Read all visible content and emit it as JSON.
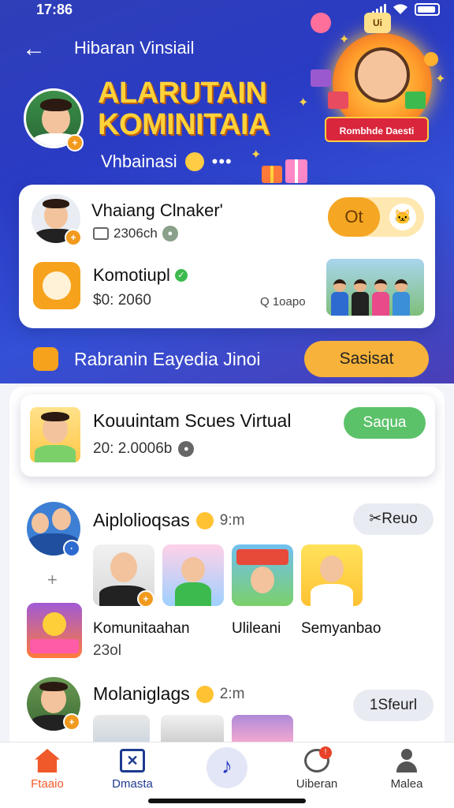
{
  "status_bar": {
    "time": "17:86"
  },
  "header": {
    "title": "Hibaran Vinsiail"
  },
  "promo": {
    "banner_text": "Rombhde Daesti",
    "badge_text": "Ui"
  },
  "hero": {
    "title_line1": "ALARUTAIN",
    "title_line2": "KOMINITAIA",
    "subtitle": "Vhbainasi",
    "dots": "•••"
  },
  "card1": {
    "user_name": "Vhaiang Clnaker'",
    "user_meta": "2306ch",
    "toggle_label": "Ot",
    "app_name": "Komotiupl",
    "app_meta": "$0: 2060",
    "search_meta": "Q 1oapo"
  },
  "section": {
    "title": "Rabranin Eayedia Jinoi",
    "button_label": "Sasisat"
  },
  "card2": {
    "title": "Kouuintam Scues Virtual",
    "meta": "20: 2.0006b",
    "button_label": "Saqua"
  },
  "post1": {
    "name": "Aiplolioqsas",
    "time": "9:m",
    "button_label": "Reuo",
    "captions": [
      "Komunitaahan",
      "Ulileani",
      "Semyanbao"
    ],
    "sub_caption": "23ol"
  },
  "post2": {
    "name": "Molaniglags",
    "time": "2:m",
    "button_label": "1Sfeurl"
  },
  "bottom_nav": {
    "items": [
      {
        "label": "Ftaaio"
      },
      {
        "label": "Dmasta"
      },
      {
        "label": "Uiberan"
      },
      {
        "label": "Malea"
      }
    ]
  },
  "colors": {
    "hero_blue": "#2a3bc4",
    "accent_orange": "#f6a623",
    "accent_green": "#5cc26a",
    "title_yellow": "#ffd23a"
  }
}
